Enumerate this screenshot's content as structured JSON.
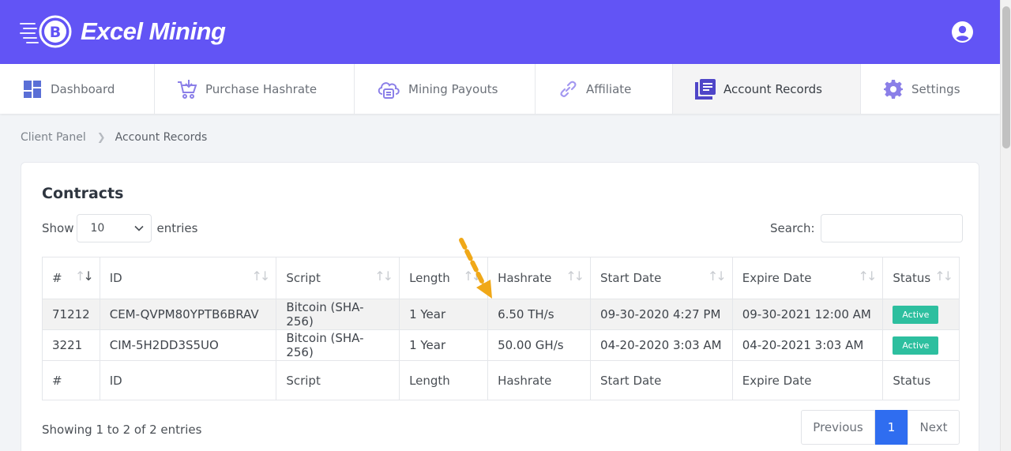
{
  "header": {
    "brand": "Excel Mining",
    "brand_icon": "bitcoin-coin-icon",
    "user_icon": "user-circle-icon",
    "bg_color": "#6254f5"
  },
  "nav": {
    "items": [
      {
        "label": "Dashboard",
        "icon": "dashboard-grid-icon"
      },
      {
        "label": "Purchase Hashrate",
        "icon": "cart-icon"
      },
      {
        "label": "Mining Payouts",
        "icon": "cloud-payout-icon"
      },
      {
        "label": "Affiliate",
        "icon": "link-icon"
      },
      {
        "label": "Account Records",
        "icon": "records-icon",
        "active": true
      },
      {
        "label": "Settings",
        "icon": "gear-icon"
      }
    ]
  },
  "breadcrumb": {
    "parent": "Client Panel",
    "current": "Account Records"
  },
  "contracts": {
    "title": "Contracts",
    "show_label": "Show",
    "entries_label": "entries",
    "page_size": "10",
    "search_label": "Search:",
    "search_value": "",
    "columns": [
      "#",
      "ID",
      "Script",
      "Length",
      "Hashrate",
      "Start Date",
      "Expire Date",
      "Status"
    ],
    "rows": [
      {
        "num": "71212",
        "id": "CEM-QVPM80YPTB6BRAV",
        "script": "Bitcoin (SHA-256)",
        "length": "1 Year",
        "hashrate": "6.50 TH/s",
        "start": "09-30-2020 4:27 PM",
        "expire": "09-30-2021 12:00 AM",
        "status": "Active"
      },
      {
        "num": "3221",
        "id": "CIM-5H2DD3S5UO",
        "script": "Bitcoin (SHA-256)",
        "length": "1 Year",
        "hashrate": "50.00 GH/s",
        "start": "04-20-2020 3:03 AM",
        "expire": "04-20-2021 3:03 AM",
        "status": "Active"
      }
    ],
    "info": "Showing 1 to 2 of 2 entries",
    "pagination": {
      "previous": "Previous",
      "current": "1",
      "next": "Next"
    },
    "status_color": "#2dbf9f",
    "accent_color": "#2f6df0",
    "annotation_color": "#f0a818"
  }
}
